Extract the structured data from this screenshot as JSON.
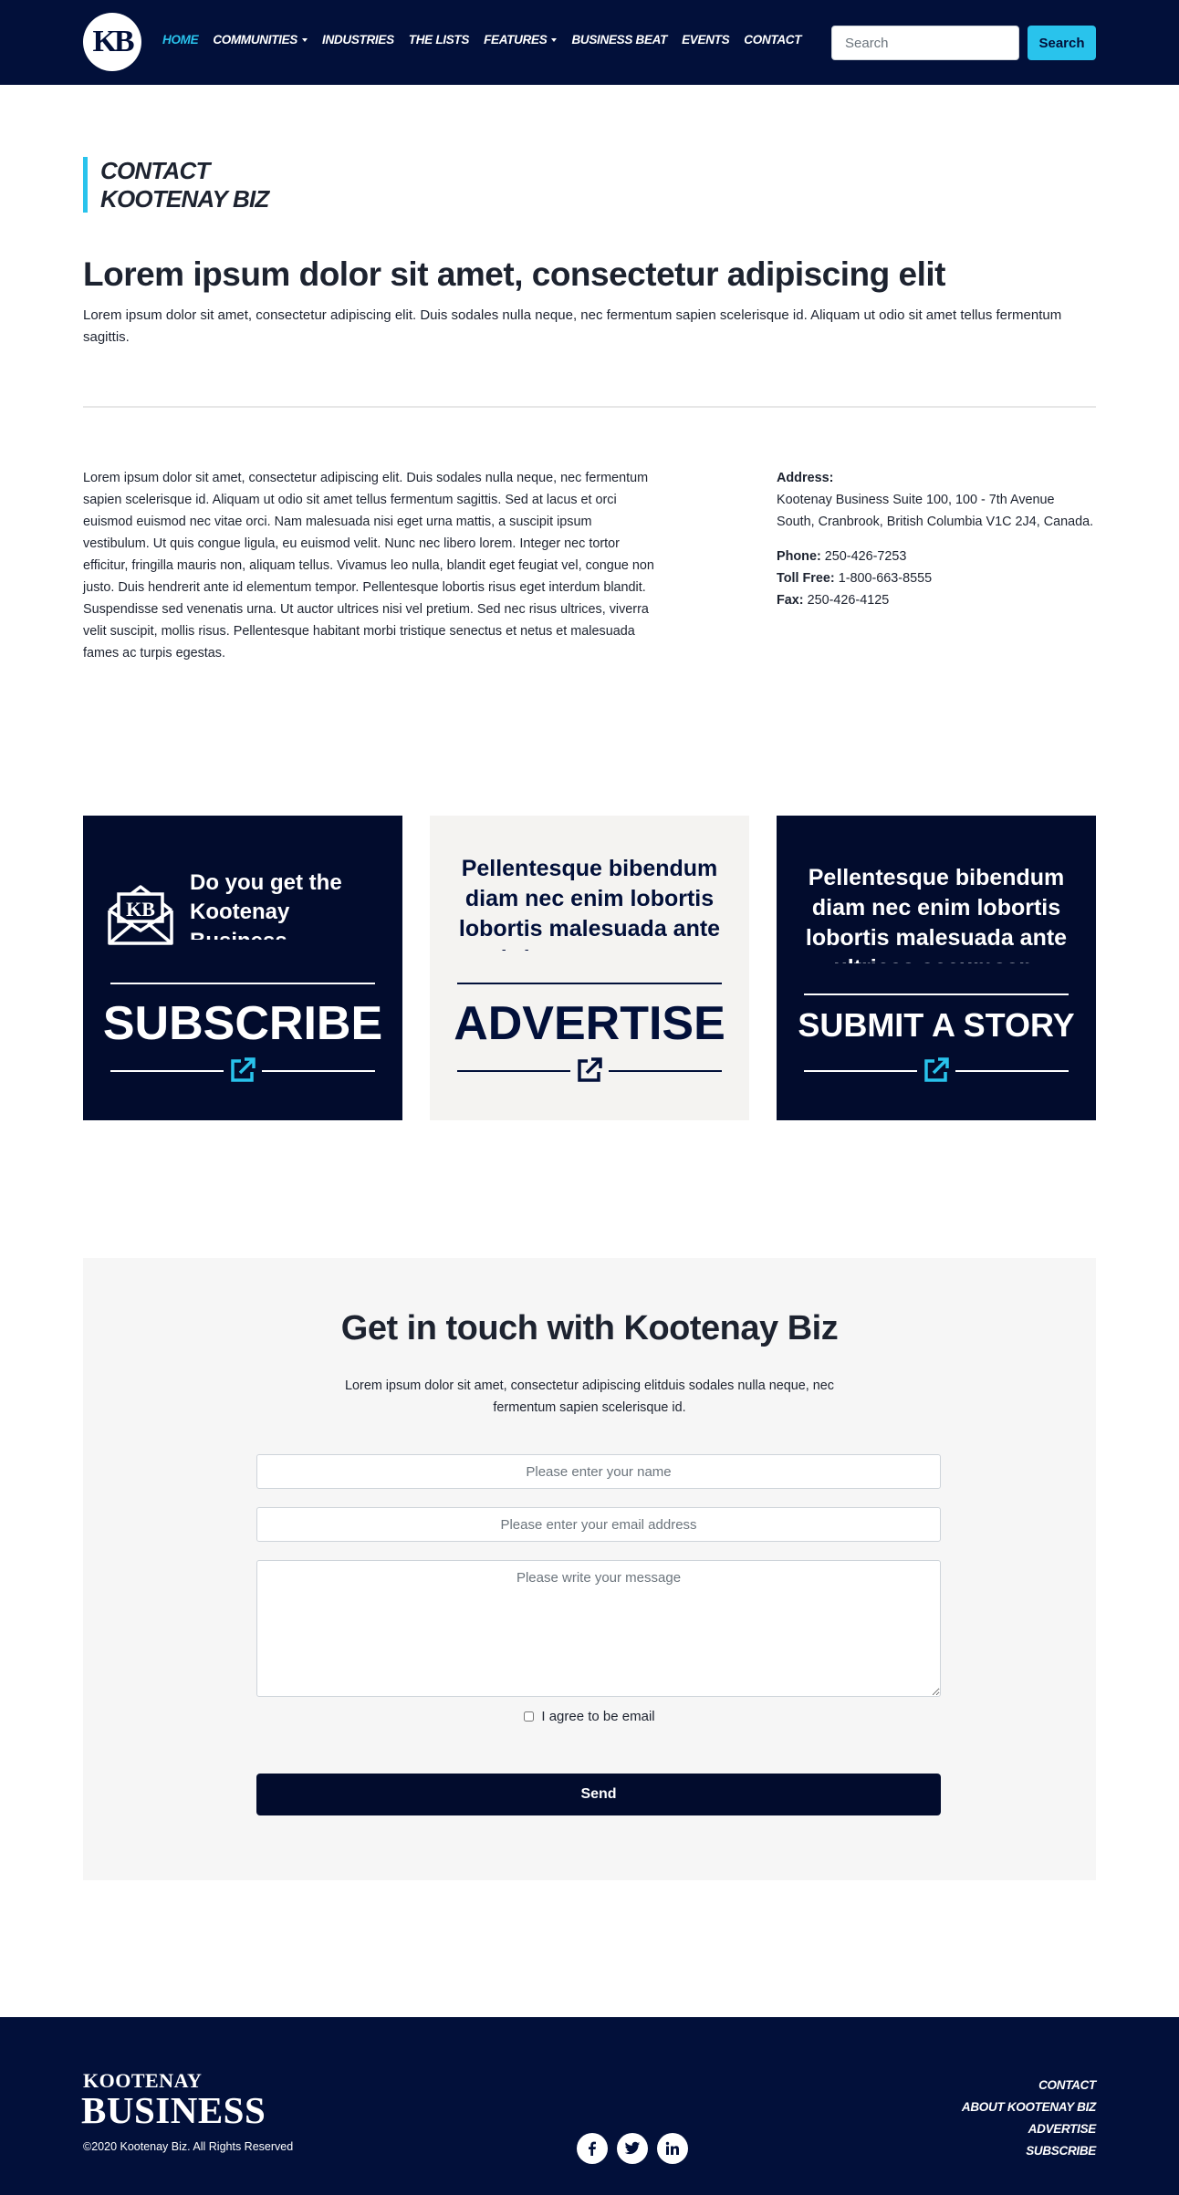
{
  "nav": {
    "logo_text": "KB",
    "items": [
      {
        "label": "HOME",
        "active": true,
        "dropdown": false
      },
      {
        "label": "COMMUNITIES",
        "active": false,
        "dropdown": true
      },
      {
        "label": "INDUSTRIES",
        "active": false,
        "dropdown": false
      },
      {
        "label": "THE LISTS",
        "active": false,
        "dropdown": false
      },
      {
        "label": "FEATURES",
        "active": false,
        "dropdown": true
      },
      {
        "label": "BUSINESS BEAT",
        "active": false,
        "dropdown": false
      },
      {
        "label": "EVENTS",
        "active": false,
        "dropdown": false
      },
      {
        "label": "CONTACT",
        "active": false,
        "dropdown": false
      }
    ],
    "search_placeholder": "Search",
    "search_button": "Search"
  },
  "header": {
    "label_line1": "CONTACT",
    "label_line2": "KOOTENAY BIZ",
    "title": "Lorem ipsum dolor sit amet, consectetur adipiscing elit",
    "intro": "Lorem ipsum dolor sit amet, consectetur adipiscing elit. Duis sodales nulla neque, nec fermentum sapien scelerisque id. Aliquam ut odio sit amet tellus fermentum sagittis."
  },
  "contact": {
    "body": "Lorem ipsum dolor sit amet, consectetur adipiscing elit. Duis sodales nulla neque, nec fermentum sapien scelerisque id. Aliquam ut odio sit amet tellus fermentum sagittis. Sed at lacus et orci euismod euismod nec vitae orci. Nam malesuada nisi eget urna mattis, a suscipit ipsum vestibulum. Ut quis congue ligula, eu euismod velit. Nunc nec libero lorem. Integer nec tortor efficitur, fringilla mauris non, aliquam tellus. Vivamus leo nulla, blandit eget feugiat vel, congue non justo. Duis hendrerit ante id elementum tempor. Pellentesque lobortis risus eget interdum blandit. Suspendisse sed venenatis urna. Ut auctor ultrices nisi vel pretium. Sed nec risus ultrices, viverra velit suscipit, mollis risus. Pellentesque habitant morbi tristique senectus et netus et malesuada fames ac turpis egestas.",
    "address_label": "Address:",
    "address": "Kootenay Business Suite 100, 100 - 7th Avenue South, Cranbrook, British Columbia V1C 2J4, Canada.",
    "phone_label": "Phone:",
    "phone": "250-426-7253",
    "tollfree_label": "Toll Free:",
    "tollfree": "1-800-663-8555",
    "fax_label": "Fax:",
    "fax": "250-426-4125"
  },
  "cards": {
    "subscribe": {
      "heading": "Do you get the Kootenay Business newsletter?",
      "title": "SUBSCRIBE"
    },
    "advertise": {
      "heading": "Pellentesque bibendum diam nec enim lobortis lobortis malesuada ante ultrices accumsan.",
      "title": "ADVERTISE"
    },
    "story": {
      "heading": "Pellentesque bibendum diam nec enim lobortis lobortis malesuada ante ultrices accumsan.",
      "title": "SUBMIT A STORY"
    }
  },
  "form": {
    "title": "Get in touch with Kootenay Biz",
    "subtitle": "Lorem ipsum dolor sit amet, consectetur adipiscing elitduis sodales nulla neque, nec fermentum sapien scelerisque id.",
    "name_placeholder": "Please enter your name",
    "email_placeholder": "Please enter your email address",
    "message_placeholder": "Please write your message",
    "agree_label": "I agree to be email",
    "send_label": "Send"
  },
  "footer": {
    "brand_top": "KOOTENAY",
    "brand_bottom": "BUSINESS",
    "copyright": "©2020 Kootenay Biz. All Rights Reserved",
    "socials": [
      "facebook-icon",
      "twitter-icon",
      "linkedin-icon"
    ],
    "links": [
      "CONTACT",
      "ABOUT KOOTENAY BIZ",
      "ADVERTISE",
      "SUBSCRIBE"
    ]
  },
  "colors": {
    "navy": "#02103a",
    "accent": "#29c3ec",
    "panel": "#f6f6f6",
    "card_light": "#f4f3f1"
  }
}
